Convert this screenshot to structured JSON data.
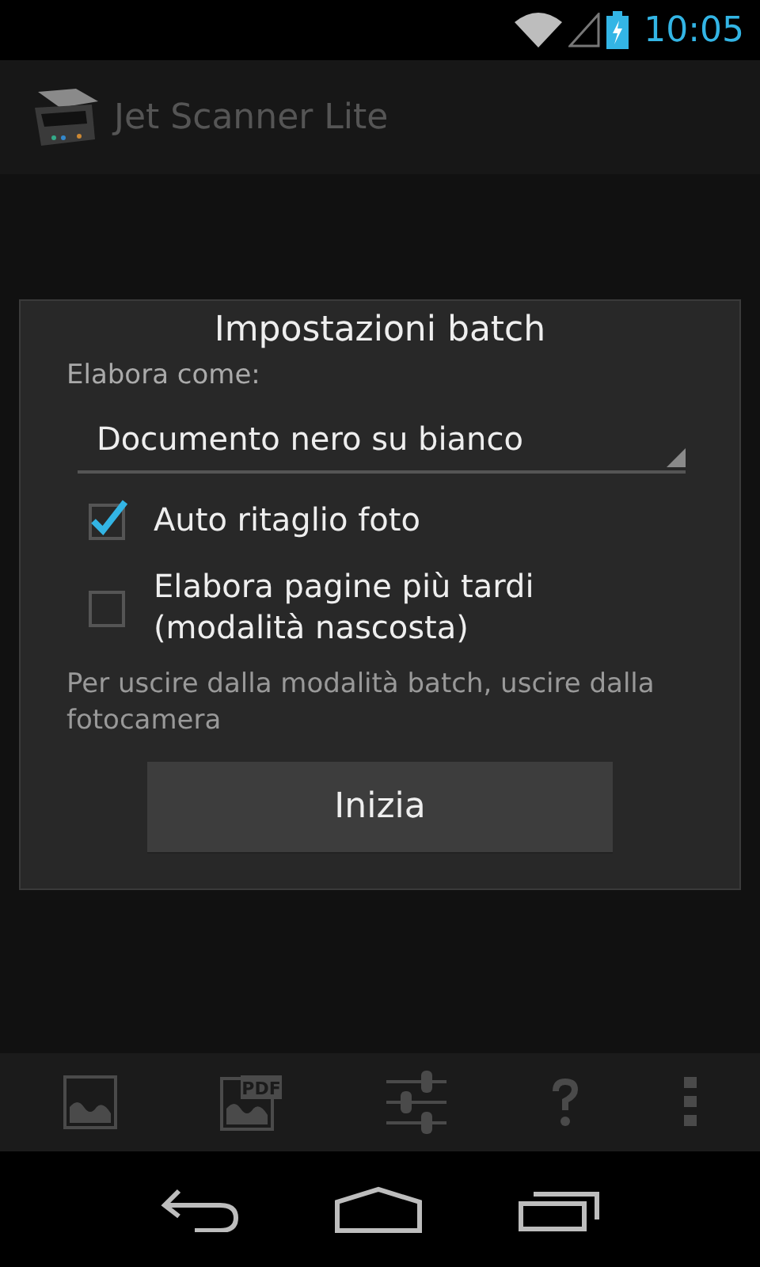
{
  "status_bar": {
    "time": "10:05"
  },
  "action_bar": {
    "title": "Jet Scanner Lite"
  },
  "dialog": {
    "title": "Impostazioni batch",
    "label": "Elabora come:",
    "spinner": {
      "value": "Documento nero su bianco"
    },
    "options": [
      {
        "label": "Auto ritaglio foto",
        "checked": true
      },
      {
        "label": "Elabora pagine più tardi (modalità nascosta)",
        "checked": false
      }
    ],
    "note": "Per uscire dalla modalità batch, uscire dalla fotocamera",
    "button": "Inizia"
  },
  "toolbar": [
    {
      "kind": "gallery"
    },
    {
      "kind": "pdf",
      "badge": "PDF"
    },
    {
      "kind": "settings"
    },
    {
      "kind": "help"
    },
    {
      "kind": "overflow"
    }
  ]
}
